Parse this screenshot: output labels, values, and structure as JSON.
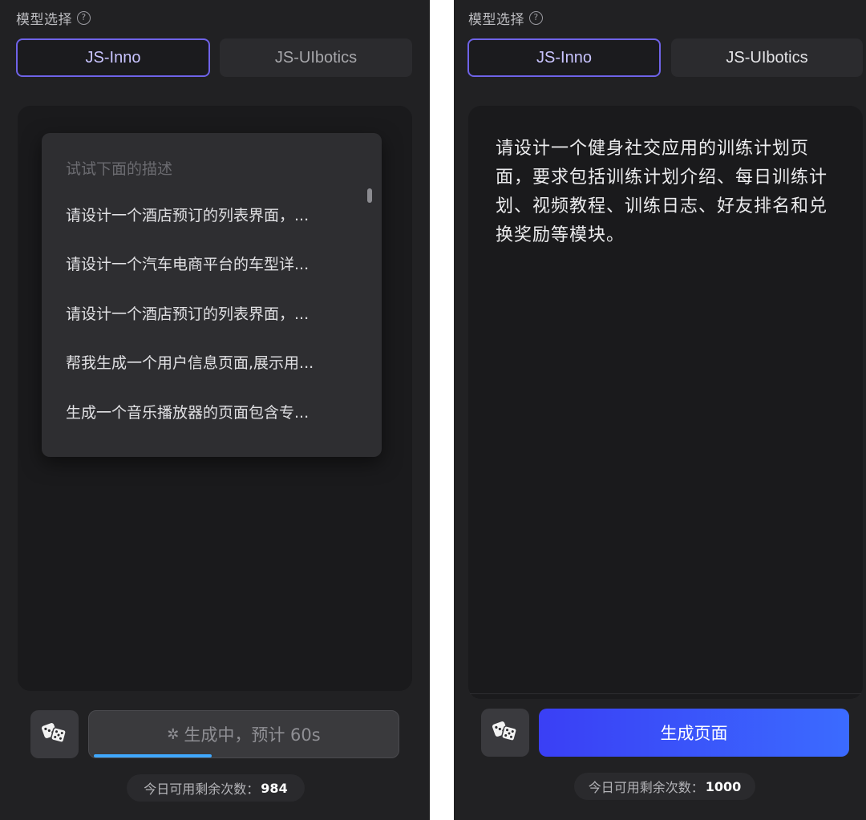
{
  "left": {
    "model_label": "模型选择",
    "tabs": [
      {
        "label": "JS-Inno",
        "active": true
      },
      {
        "label": "JS-UIbotics",
        "active": false
      }
    ],
    "dropdown": {
      "title": "试试下面的描述",
      "items": [
        "请设计一个酒店预订的列表界面，...",
        "请设计一个汽车电商平台的车型详...",
        "请设计一个酒店预订的列表界面，...",
        "帮我生成一个用户信息页面,展示用...",
        "生成一个音乐播放器的页面包含专..."
      ]
    },
    "generate_status": "生成中，预计 60s",
    "progress": 0.38,
    "quota_label": "今日可用剩余次数：",
    "quota_value": "984"
  },
  "right": {
    "model_label": "模型选择",
    "tabs": [
      {
        "label": "JS-Inno",
        "active": true
      },
      {
        "label": "JS-UIbotics",
        "active": false
      }
    ],
    "prompt": "请设计一个健身社交应用的训练计划页面，要求包括训练计划介绍、每日训练计划、视频教程、训练日志、好友排名和兑换奖励等模块。",
    "generate_label": "生成页面",
    "quota_label": "今日可用剩余次数：",
    "quota_value": "1000"
  },
  "icons": {
    "help": "help-circle-icon",
    "dice": "dice-icon",
    "spinner": "spinner-icon"
  },
  "colors": {
    "accent": "#6f63e8",
    "button": "#3a3ff5",
    "progress": "#3fa8ff",
    "panel": "#212123"
  }
}
